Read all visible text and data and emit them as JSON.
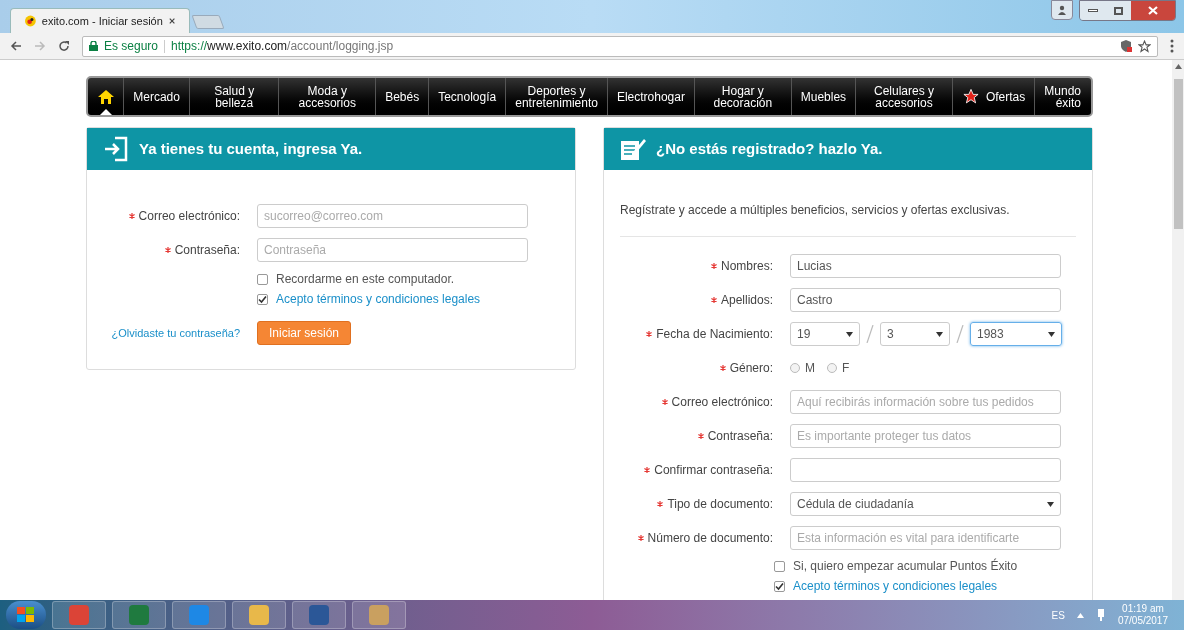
{
  "browser": {
    "tab_title": "exito.com - Iniciar sesión",
    "secure_label": "Es seguro",
    "url_scheme": "https://",
    "url_host": "www.exito.com",
    "url_path": "/account/logging.jsp"
  },
  "nav": [
    {
      "kind": "home",
      "selected": true
    },
    {
      "kind": "text",
      "label": "Mercado",
      "selected": false
    },
    {
      "kind": "text",
      "label": "Salud y belleza",
      "selected": false
    },
    {
      "kind": "text",
      "label": "Moda y accesorios",
      "selected": false
    },
    {
      "kind": "text",
      "label": "Bebés",
      "selected": false
    },
    {
      "kind": "text",
      "label": "Tecnología",
      "selected": false
    },
    {
      "kind": "text",
      "label": "Deportes y entretenimiento",
      "selected": false
    },
    {
      "kind": "text",
      "label": "Electrohogar",
      "selected": false
    },
    {
      "kind": "text",
      "label": "Hogar y decoración",
      "selected": false
    },
    {
      "kind": "text",
      "label": "Muebles",
      "selected": false
    },
    {
      "kind": "text",
      "label": "Celulares y accesorios",
      "selected": false
    },
    {
      "kind": "star",
      "label": "Ofertas",
      "selected": false
    },
    {
      "kind": "text",
      "label": "Mundo éxito",
      "selected": false
    }
  ],
  "login": {
    "title": "Ya tienes tu cuenta, ingresa Ya.",
    "fields": [
      {
        "label": "Correo electrónico:",
        "placeholder": "sucorreo@correo.com"
      },
      {
        "label": "Contraseña:",
        "placeholder": "Contraseña"
      }
    ],
    "checkboxes": [
      {
        "label": "Recordarme en este computador.",
        "checked": false,
        "kind": "text"
      },
      {
        "label": "Acepto términos y condiciones legales",
        "checked": true,
        "kind": "link"
      }
    ],
    "forgot_link": "¿Olvidaste tu contraseña?",
    "submit": "Iniciar sesión"
  },
  "register": {
    "title": "¿No estás registrado? hazlo Ya.",
    "intro": "Regístrate y accede a múltiples beneficios, servicios y ofertas exclusivas.",
    "fields": [
      {
        "kind": "text",
        "label": "Nombres:",
        "value": "Lucias"
      },
      {
        "kind": "text",
        "label": "Apellidos:",
        "value": "Castro"
      },
      {
        "kind": "date",
        "label": "Fecha de Nacimiento:",
        "selects": [
          {
            "value": "19",
            "focused": false
          },
          {
            "value": "3",
            "focused": false
          },
          {
            "value": "1983",
            "focused": true
          }
        ]
      },
      {
        "kind": "radio",
        "label": "Género:",
        "options": [
          {
            "label": "M",
            "selected": false
          },
          {
            "label": "F",
            "selected": false
          }
        ]
      },
      {
        "kind": "text",
        "label": "Correo electrónico:",
        "placeholder": "Aquí recibirás información sobre tus pedidos"
      },
      {
        "kind": "text",
        "label": "Contraseña:",
        "placeholder": "Es importante proteger tus datos"
      },
      {
        "kind": "text",
        "label": "Confirmar contraseña:"
      },
      {
        "kind": "select",
        "label": "Tipo de documento:",
        "value": "Cédula de ciudadanía"
      },
      {
        "kind": "text",
        "label": "Número de documento:",
        "placeholder": "Esta información es vital para identificarte"
      }
    ],
    "checkboxes": [
      {
        "label": "Si, quiero empezar acumular Puntos Éxito",
        "checked": false,
        "kind": "text"
      },
      {
        "label": "Acepto términos y condiciones legales",
        "checked": true,
        "kind": "link"
      }
    ]
  },
  "taskbar": {
    "language": "ES",
    "time": "01:19 am",
    "date": "07/05/2017"
  }
}
